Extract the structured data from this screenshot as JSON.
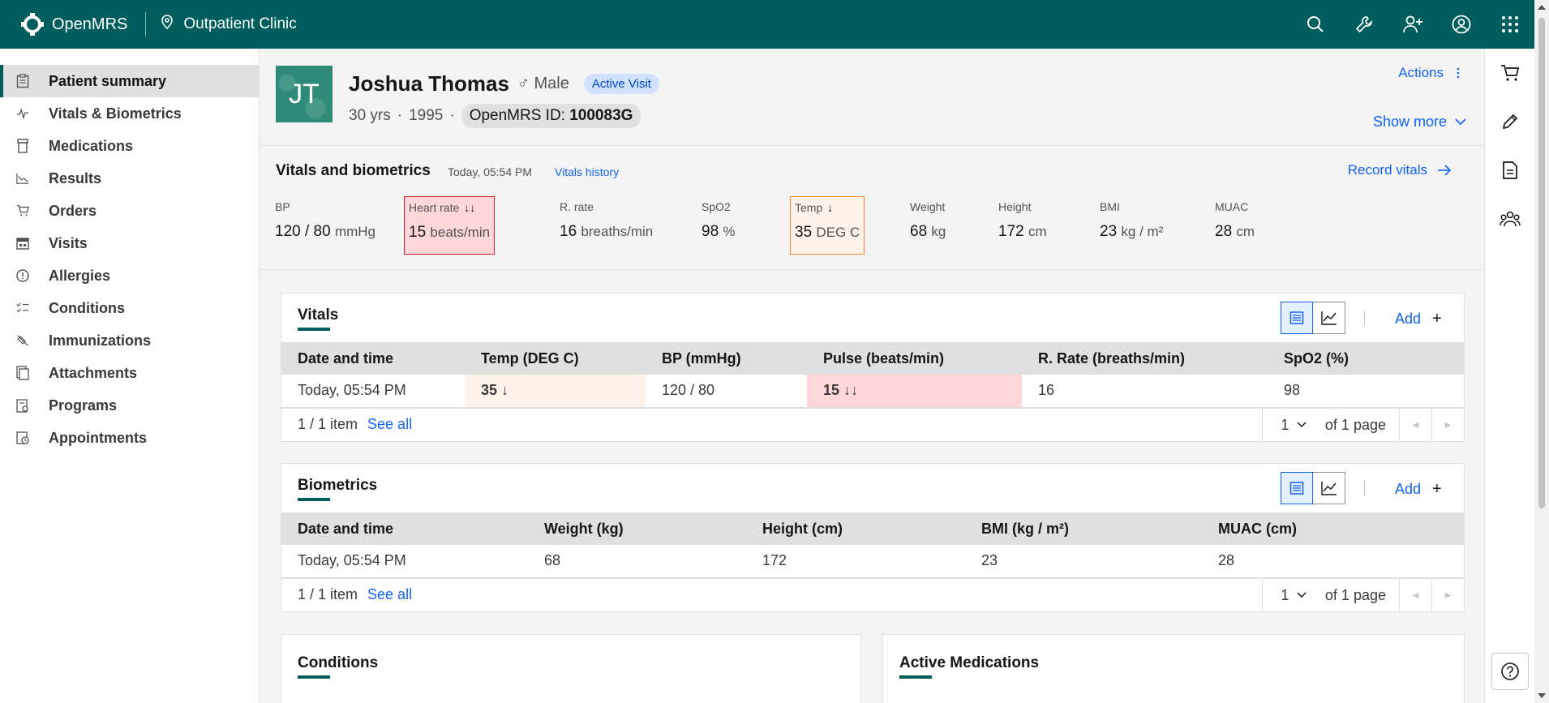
{
  "app": {
    "brand": "OpenMRS",
    "location": "Outpatient Clinic"
  },
  "nav": {
    "items": [
      {
        "label": "Patient summary",
        "icon": "clipboard-icon",
        "active": true
      },
      {
        "label": "Vitals & Biometrics",
        "icon": "activity-icon"
      },
      {
        "label": "Medications",
        "icon": "medication-icon"
      },
      {
        "label": "Results",
        "icon": "chart-line-icon"
      },
      {
        "label": "Orders",
        "icon": "cart-icon"
      },
      {
        "label": "Visits",
        "icon": "calendar-icon"
      },
      {
        "label": "Allergies",
        "icon": "warning-circle-icon"
      },
      {
        "label": "Conditions",
        "icon": "checklist-icon"
      },
      {
        "label": "Immunizations",
        "icon": "syringe-icon"
      },
      {
        "label": "Attachments",
        "icon": "attachment-icon"
      },
      {
        "label": "Programs",
        "icon": "programs-icon"
      },
      {
        "label": "Appointments",
        "icon": "appointment-icon"
      }
    ]
  },
  "patient": {
    "initials": "JT",
    "name": "Joshua Thomas",
    "gender_symbol": "♂",
    "gender": "Male",
    "visit_tag": "Active Visit",
    "age": "30 yrs",
    "birth_year": "1995",
    "id_label": "OpenMRS ID:",
    "id_value": "100083G",
    "actions_label": "Actions",
    "show_more_label": "Show more"
  },
  "vitals_header": {
    "title": "Vitals and biometrics",
    "date": "Today, 05:54 PM",
    "history_link": "Vitals history",
    "record_label": "Record vitals",
    "tiles": [
      {
        "label": "BP",
        "value": "120 / 80",
        "unit": "mmHg"
      },
      {
        "label": "Heart rate",
        "flag": "↓↓",
        "value": "15",
        "unit": "beats/min",
        "status": "critical"
      },
      {
        "label": "R. rate",
        "value": "16",
        "unit": "breaths/min"
      },
      {
        "label": "SpO2",
        "value": "98",
        "unit": "%"
      },
      {
        "label": "Temp",
        "flag": "↓",
        "value": "35",
        "unit": "DEG C",
        "status": "low"
      },
      {
        "label": "Weight",
        "value": "68",
        "unit": "kg"
      },
      {
        "label": "Height",
        "value": "172",
        "unit": "cm"
      },
      {
        "label": "BMI",
        "value": "23",
        "unit": "kg / m²"
      },
      {
        "label": "MUAC",
        "value": "28",
        "unit": "cm"
      }
    ]
  },
  "vitals_card": {
    "title": "Vitals",
    "add_label": "Add",
    "columns": [
      "Date and time",
      "Temp (DEG C)",
      "BP (mmHg)",
      "Pulse (beats/min)",
      "R. Rate (breaths/min)",
      "SpO2 (%)"
    ],
    "row": {
      "date": "Today, 05:54 PM",
      "temp": "35 ↓",
      "bp": "120 / 80",
      "pulse": "15 ↓↓",
      "rrate": "16",
      "spo2": "98"
    },
    "pager": {
      "count": "1 / 1 item",
      "see_all": "See all",
      "page": "1",
      "of_pages": "of 1 page"
    }
  },
  "biometrics_card": {
    "title": "Biometrics",
    "add_label": "Add",
    "columns": [
      "Date and time",
      "Weight (kg)",
      "Height (cm)",
      "BMI (kg / m²)",
      "MUAC (cm)"
    ],
    "row": {
      "date": "Today, 05:54 PM",
      "weight": "68",
      "height": "172",
      "bmi": "23",
      "muac": "28"
    },
    "pager": {
      "count": "1 / 1 item",
      "see_all": "See all",
      "page": "1",
      "of_pages": "of 1 page"
    }
  },
  "conditions_card": {
    "title": "Conditions"
  },
  "medications_card": {
    "title": "Active Medications"
  },
  "colors": {
    "brand": "#005d5d",
    "link": "#0f62fe",
    "critical_bg": "#ffd7d9",
    "low_bg": "#fff2e8"
  }
}
